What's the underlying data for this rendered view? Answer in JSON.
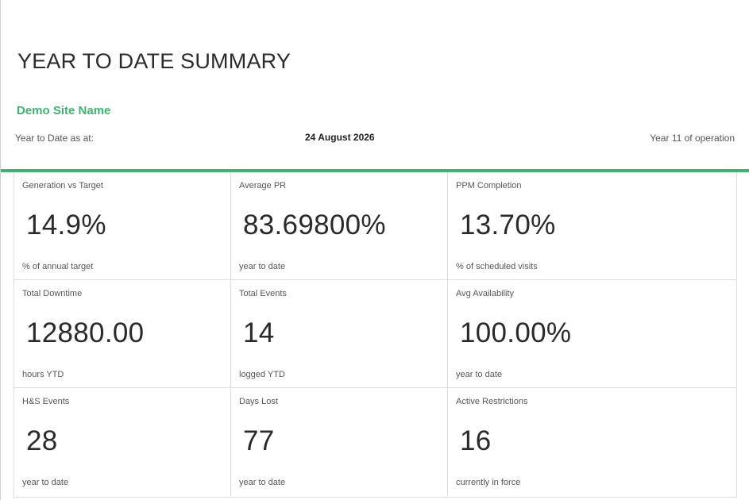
{
  "page": {
    "title": "YEAR TO DATE SUMMARY",
    "site_name": "Demo Site Name",
    "as_at_label": "Year to Date as at:",
    "as_at_date": "24 August 2026",
    "operation_year": "Year 11 of operation",
    "accent_color": "#3cb371"
  },
  "cards": [
    {
      "label": "Generation vs Target",
      "value": "14.9%",
      "sub": "% of annual target"
    },
    {
      "label": "Average PR",
      "value": "83.69800%",
      "sub": "year to date"
    },
    {
      "label": "PPM Completion",
      "value": "13.70%",
      "sub": "% of scheduled visits"
    },
    {
      "label": "Total Downtime",
      "value": "12880.00",
      "sub": "hours YTD"
    },
    {
      "label": "Total Events",
      "value": "14",
      "sub": "logged YTD"
    },
    {
      "label": "Avg Availability",
      "value": "100.00%",
      "sub": "year to date"
    },
    {
      "label": "H&S Events",
      "value": "28",
      "sub": "year to date"
    },
    {
      "label": "Days Lost",
      "value": "77",
      "sub": "year to date"
    },
    {
      "label": "Active Restrictions",
      "value": "16",
      "sub": "currently in force"
    }
  ]
}
